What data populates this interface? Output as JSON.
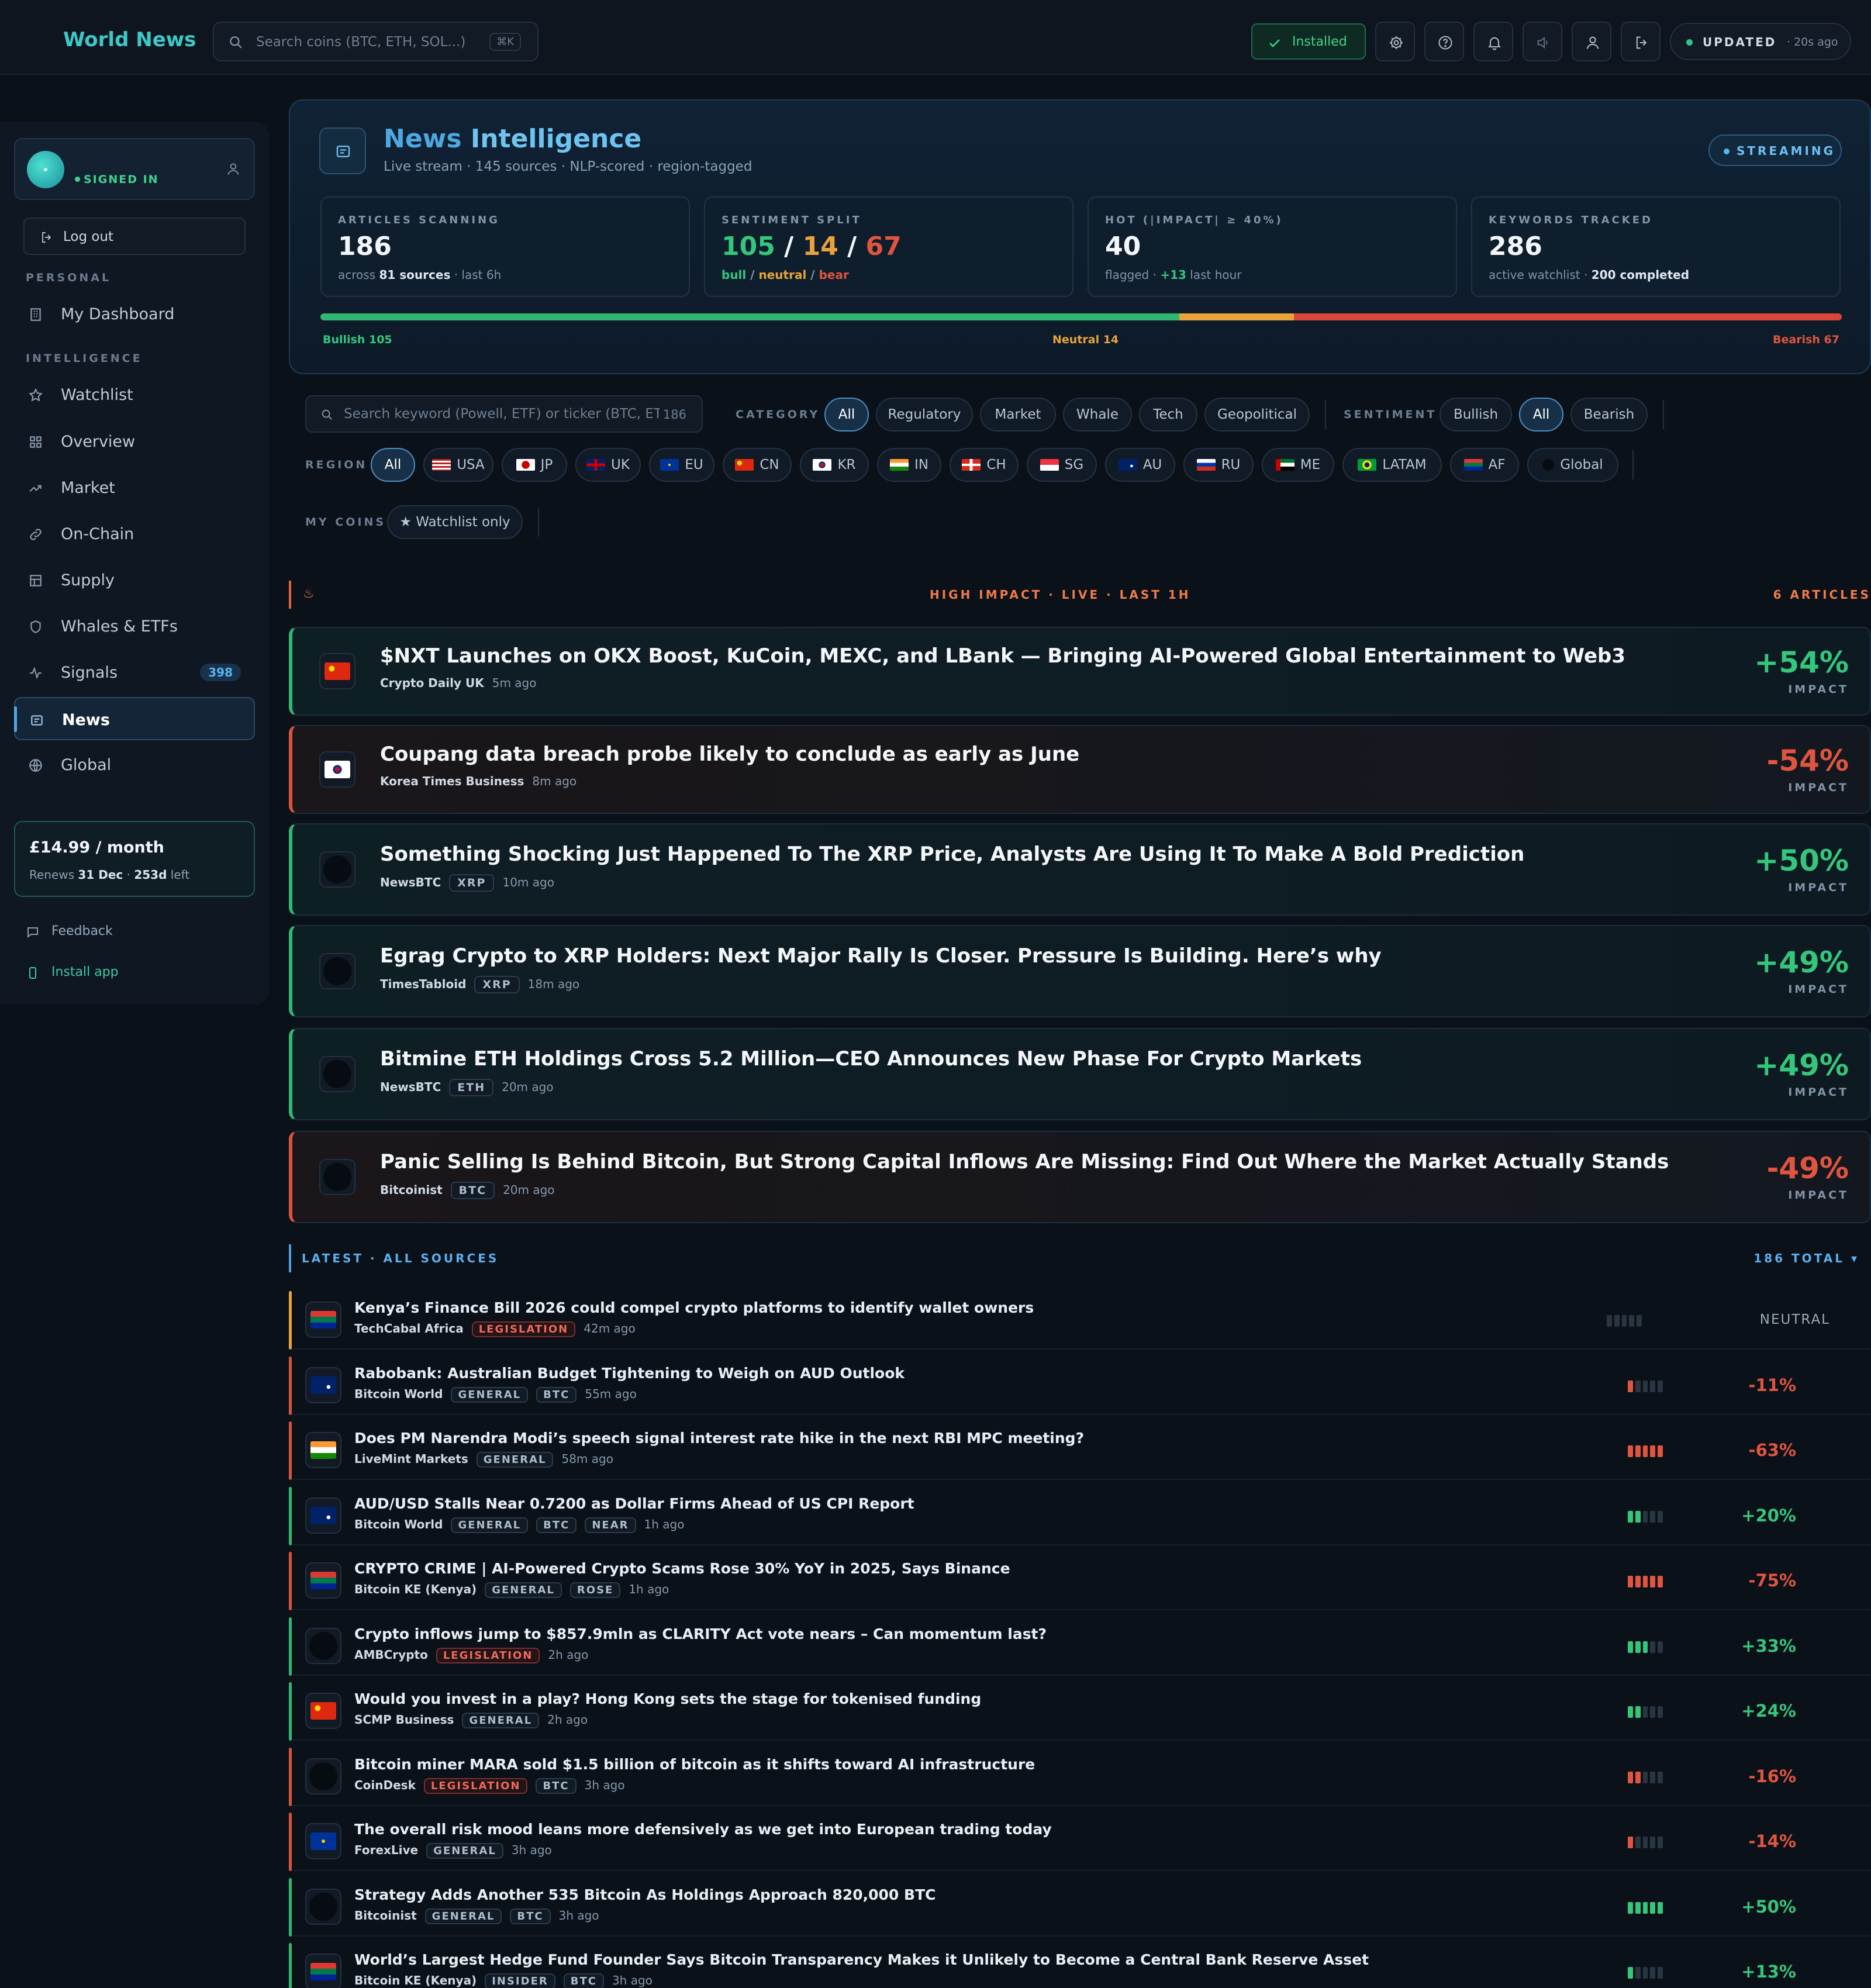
{
  "topbar": {
    "brand": "World News",
    "search_placeholder": "Search coins (BTC, ETH, SOL...)",
    "search_shortcut": "⌘K",
    "installed_label": "Installed",
    "updated_label": "UPDATED",
    "updated_ago": "· 20s ago"
  },
  "sidebar": {
    "status": "SIGNED IN",
    "logout": "Log out",
    "section_personal": "PERSONAL",
    "section_intel": "INTELLIGENCE",
    "personal_items": [
      {
        "label": "My Dashboard",
        "icon": "building-icon"
      }
    ],
    "items": [
      {
        "label": "Watchlist",
        "icon": "star-icon"
      },
      {
        "label": "Overview",
        "icon": "grid-icon"
      },
      {
        "label": "Market",
        "icon": "trend-icon"
      },
      {
        "label": "On-Chain",
        "icon": "link-icon"
      },
      {
        "label": "Supply",
        "icon": "box-icon"
      },
      {
        "label": "Whales & ETFs",
        "icon": "shield-icon"
      },
      {
        "label": "Signals",
        "icon": "pulse-icon",
        "badge": "398"
      },
      {
        "label": "News",
        "icon": "news-icon"
      },
      {
        "label": "Global",
        "icon": "globe-icon"
      }
    ],
    "plan_price": "£14.99 / month",
    "plan_renews_prefix": "Renews",
    "plan_renews_date": "31 Dec",
    "plan_renews_left": "253d",
    "plan_renews_suffix": "left",
    "feedback": "Feedback",
    "install": "Install app"
  },
  "intel": {
    "title_a": "News",
    "title_b": "Intelligence",
    "subtitle": "Live stream · 145 sources · NLP-scored · region-tagged",
    "streaming": "STREAMING",
    "stats": [
      {
        "label": "ARTICLES SCANNING",
        "value": "186",
        "sub_a": "across",
        "sub_b": "81 sources",
        "sub_c": "· last 6h"
      },
      {
        "label": "SENTIMENT SPLIT",
        "bull": "105",
        "neutral": "14",
        "bear": "67",
        "sub_bull": "bull",
        "sub_neutral": "neutral",
        "sub_bear": "bear"
      },
      {
        "label": "HOT (|IMPACT| ≥ 40%)",
        "value": "40",
        "sub_a": "flagged ·",
        "sub_b": "+13",
        "sub_c": "last hour"
      },
      {
        "label": "KEYWORDS TRACKED",
        "value": "286",
        "sub_a": "active watchlist ·",
        "sub_b": "200 completed"
      }
    ],
    "split": {
      "bull": 105,
      "neutral": 14,
      "bear": 67,
      "bull_label": "Bullish 105",
      "neutral_label": "Neutral 14",
      "bear_label": "Bearish 67"
    }
  },
  "filters": {
    "search_placeholder": "Search keyword (Powell, ETF) or ticker (BTC, ETH)",
    "search_count": "186",
    "category_label": "CATEGORY",
    "categories": [
      "All",
      "Regulatory",
      "Market",
      "Whale",
      "Tech",
      "Geopolitical"
    ],
    "sentiment_label": "SENTIMENT",
    "sentiments": [
      "Bullish",
      "All",
      "Bearish"
    ],
    "region_label": "REGION",
    "regions": [
      "All",
      "USA",
      "JP",
      "UK",
      "EU",
      "CN",
      "KR",
      "IN",
      "CH",
      "SG",
      "AU",
      "RU",
      "ME",
      "LATAM",
      "AF",
      "Global"
    ],
    "mycoins_label": "MY COINS",
    "watchlist_only": "★ Watchlist only"
  },
  "high_impact": {
    "title": "HIGH IMPACT · LIVE · LAST 1H",
    "count": "6 ARTICLES",
    "impact_label": "IMPACT",
    "items": [
      {
        "title": "$NXT Launches on OKX Boost, KuCoin, MEXC, and LBank — Bringing AI-Powered Global Entertainment to Web3",
        "source": "Crypto Daily UK",
        "tag": "",
        "time": "5m ago",
        "impact": "+54%",
        "flag": "cn"
      },
      {
        "title": "Coupang data breach probe likely to conclude as early as June",
        "source": "Korea Times Business",
        "tag": "",
        "time": "8m ago",
        "impact": "-54%",
        "flag": "kr"
      },
      {
        "title": "Something Shocking Just Happened To The XRP Price, Analysts Are Using It To Make A Bold Prediction",
        "source": "NewsBTC",
        "tag": "XRP",
        "time": "10m ago",
        "impact": "+50%",
        "flag": "none"
      },
      {
        "title": "Egrag Crypto to XRP Holders: Next Major Rally Is Closer. Pressure Is Building. Here’s why",
        "source": "TimesTabloid",
        "tag": "XRP",
        "time": "18m ago",
        "impact": "+49%",
        "flag": "none"
      },
      {
        "title": "Bitmine ETH Holdings Cross 5.2 Million—CEO Announces New Phase For Crypto Markets",
        "source": "NewsBTC",
        "tag": "ETH",
        "time": "20m ago",
        "impact": "+49%",
        "flag": "none"
      },
      {
        "title": "Panic Selling Is Behind Bitcoin, But Strong Capital Inflows Are Missing: Find Out Where the Market Actually Stands",
        "source": "Bitcoinist",
        "tag": "BTC",
        "time": "20m ago",
        "impact": "-49%",
        "flag": "none"
      }
    ]
  },
  "latest": {
    "title": "LATEST · ALL SOURCES",
    "count": "186 TOTAL",
    "toggle": "▾",
    "items": [
      {
        "title": "Kenya’s Finance Bill 2026 could compel crypto platforms to identify wallet owners",
        "source": "TechCabal Africa",
        "tags": [
          "LEGISLATION"
        ],
        "time": "42m ago",
        "value": "NEUTRAL",
        "level": 0,
        "flag": "za"
      },
      {
        "title": "Rabobank: Australian Budget Tightening to Weigh on AUD Outlook",
        "source": "Bitcoin World",
        "tags": [
          "GENERAL",
          "BTC"
        ],
        "time": "55m ago",
        "value": "-11%",
        "level": 1,
        "flag": "au"
      },
      {
        "title": "Does PM Narendra Modi’s speech signal interest rate hike in the next RBI MPC meeting?",
        "source": "LiveMint Markets",
        "tags": [
          "GENERAL"
        ],
        "time": "58m ago",
        "value": "-63%",
        "level": 5,
        "flag": "in"
      },
      {
        "title": "AUD/USD Stalls Near 0.7200 as Dollar Firms Ahead of US CPI Report",
        "source": "Bitcoin World",
        "tags": [
          "GENERAL",
          "BTC",
          "NEAR"
        ],
        "time": "1h ago",
        "value": "+20%",
        "level": 2,
        "flag": "au"
      },
      {
        "title": "CRYPTO CRIME | AI-Powered Crypto Scams Rose 30% YoY in 2025, Says Binance",
        "source": "Bitcoin KE (Kenya)",
        "tags": [
          "GENERAL",
          "ROSE"
        ],
        "time": "1h ago",
        "value": "-75%",
        "level": 5,
        "flag": "za"
      },
      {
        "title": "Crypto inflows jump to $857.9mln as CLARITY Act vote nears – Can momentum last?",
        "source": "AMBCrypto",
        "tags": [
          "LEGISLATION"
        ],
        "time": "2h ago",
        "value": "+33%",
        "level": 3,
        "flag": "none"
      },
      {
        "title": "Would you invest in a play? Hong Kong sets the stage for tokenised funding",
        "source": "SCMP Business",
        "tags": [
          "GENERAL"
        ],
        "time": "2h ago",
        "value": "+24%",
        "level": 2,
        "flag": "cn"
      },
      {
        "title": "Bitcoin miner MARA sold $1.5 billion of bitcoin as it shifts toward AI infrastructure",
        "source": "CoinDesk",
        "tags": [
          "LEGISLATION",
          "BTC"
        ],
        "time": "3h ago",
        "value": "-16%",
        "level": 2,
        "flag": "none"
      },
      {
        "title": "The overall risk mood leans more defensively as we get into European trading today",
        "source": "ForexLive",
        "tags": [
          "GENERAL"
        ],
        "time": "3h ago",
        "value": "-14%",
        "level": 1,
        "flag": "eu"
      },
      {
        "title": "Strategy Adds Another 535 Bitcoin As Holdings Approach 820,000 BTC",
        "source": "Bitcoinist",
        "tags": [
          "GENERAL",
          "BTC"
        ],
        "time": "3h ago",
        "value": "+50%",
        "level": 5,
        "flag": "none"
      },
      {
        "title": "World’s Largest Hedge Fund Founder Says Bitcoin Transparency Makes it Unlikely to Become a Central Bank Reserve Asset",
        "source": "Bitcoin KE (Kenya)",
        "tags": [
          "INSIDER",
          "BTC"
        ],
        "time": "3h ago",
        "value": "+13%",
        "level": 1,
        "flag": "za"
      }
    ]
  },
  "colors": {
    "accent": "#3ec8c8",
    "bull": "#34c77b",
    "neutral": "#e8a33a",
    "bear": "#e0553f",
    "link": "#4ea8e0"
  }
}
